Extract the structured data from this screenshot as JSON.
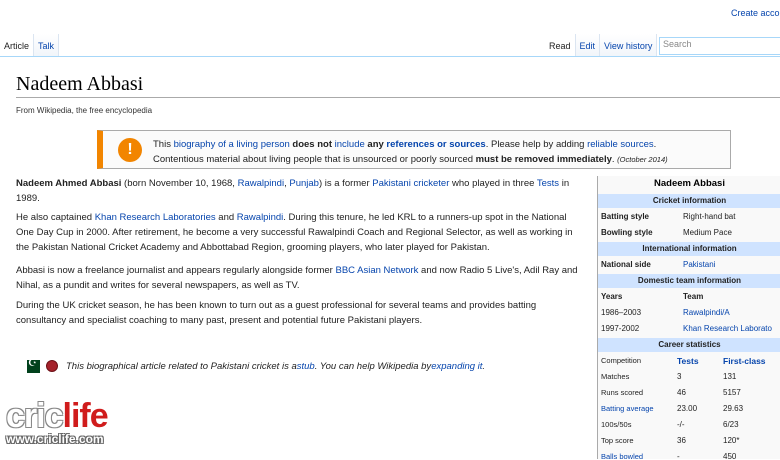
{
  "top_right": {
    "create_account": "Create accou"
  },
  "tabs_left": [
    "Article",
    "Talk"
  ],
  "tabs_right": [
    "Read",
    "Edit",
    "View history"
  ],
  "search": {
    "placeholder": "Search"
  },
  "article": {
    "title": "Nadeem Abbasi",
    "tagline": "From Wikipedia, the free encyclopedia"
  },
  "ambox": {
    "icon": "!",
    "l1_a": "This ",
    "l1_link1": "biography of a living person",
    "l1_b": " does not ",
    "l1_link2": "include",
    "l1_c": " any ",
    "l1_link3": "references or sources",
    "l1_d": ". Please help by adding ",
    "l1_link4": "reliable sources",
    "l1_e": ".",
    "l2_a": "Contentious material about living people that is unsourced or poorly sourced ",
    "l2_b": "must be removed immediately",
    "l2_c": ". ",
    "l2_date": "(October 2014)"
  },
  "paragraphs": {
    "p1": {
      "bold": "Nadeem Ahmed Abbasi",
      "t1": " (born November 10, 1968, ",
      "link1": "Rawalpindi",
      "t2": ", ",
      "link2": "Punjab",
      "t3": ") is a former ",
      "link3": "Pakistani",
      "t4": " ",
      "link4": "cricketer",
      "t5": " who played in three ",
      "link5": "Tests",
      "t6": " in 1989."
    },
    "p2": {
      "t1": "He also captained ",
      "link1": "Khan Research Laboratories",
      "t2": " and ",
      "link2": "Rawalpindi",
      "t3": ". During this tenure, he led KRL to a runners-up spot in the National One Day Cup in 2000. After retirement, he become a very successful Rawalpindi Coach and Regional Selector, as well as working in the Pakistan National Cricket Academy and Abbottabad Region, grooming players, who later played for Pakistan."
    },
    "p3": {
      "t1": "Abbasi is now a freelance journalist and appears regularly alongside former ",
      "link1": "BBC Asian Network",
      "t2": " and now Radio 5 Live's, Adil Ray and Nihal, as a pundit and writes for several newspapers, as well as TV."
    },
    "p4": {
      "t1": "During the UK cricket season, he has been known to turn out as a guest professional for several teams and provides batting consultancy and specialist coaching to many past, present and potential future Pakistani players."
    }
  },
  "stub": {
    "t1": "This biographical article related to Pakistani cricket is a ",
    "link1": "stub",
    "t2": ". You can help Wikipedia by ",
    "link2": "expanding it",
    "t3": "."
  },
  "infobox": {
    "title": "Nadeem Abbasi",
    "cricket_info": "Cricket information",
    "batting_style_k": "Batting style",
    "batting_style_v": "Right-hand bat",
    "bowling_style_k": "Bowling style",
    "bowling_style_v": "Medium Pace",
    "international_info": "International information",
    "national_side_k": "National side",
    "national_side_v": "Pakistani",
    "domestic_info": "Domestic team information",
    "years_k": "Years",
    "team_k": "Team",
    "d1_years": "1986–2003",
    "d1_team": "Rawalpindi/A",
    "d2_years": "1997-2002",
    "d2_team": "Khan Research Laborato",
    "career_stats": "Career statistics",
    "stats_header": {
      "k": "Competition",
      "c1": "Tests",
      "c2": "First-class"
    },
    "stats": [
      {
        "k": "Matches",
        "c1": "3",
        "c2": "131"
      },
      {
        "k": "Runs scored",
        "c1": "46",
        "c2": "5157"
      },
      {
        "k": "Batting average",
        "c1": "23.00",
        "c2": "29.63"
      },
      {
        "k": "100s/50s",
        "c1": "-/-",
        "c2": "6/23"
      },
      {
        "k": "Top score",
        "c1": "36",
        "c2": "120*"
      },
      {
        "k": "Balls bowled",
        "c1": "-",
        "c2": "450"
      }
    ]
  },
  "watermark": {
    "cric": "cric",
    "life": "life",
    "url": "www.criclife.com"
  }
}
